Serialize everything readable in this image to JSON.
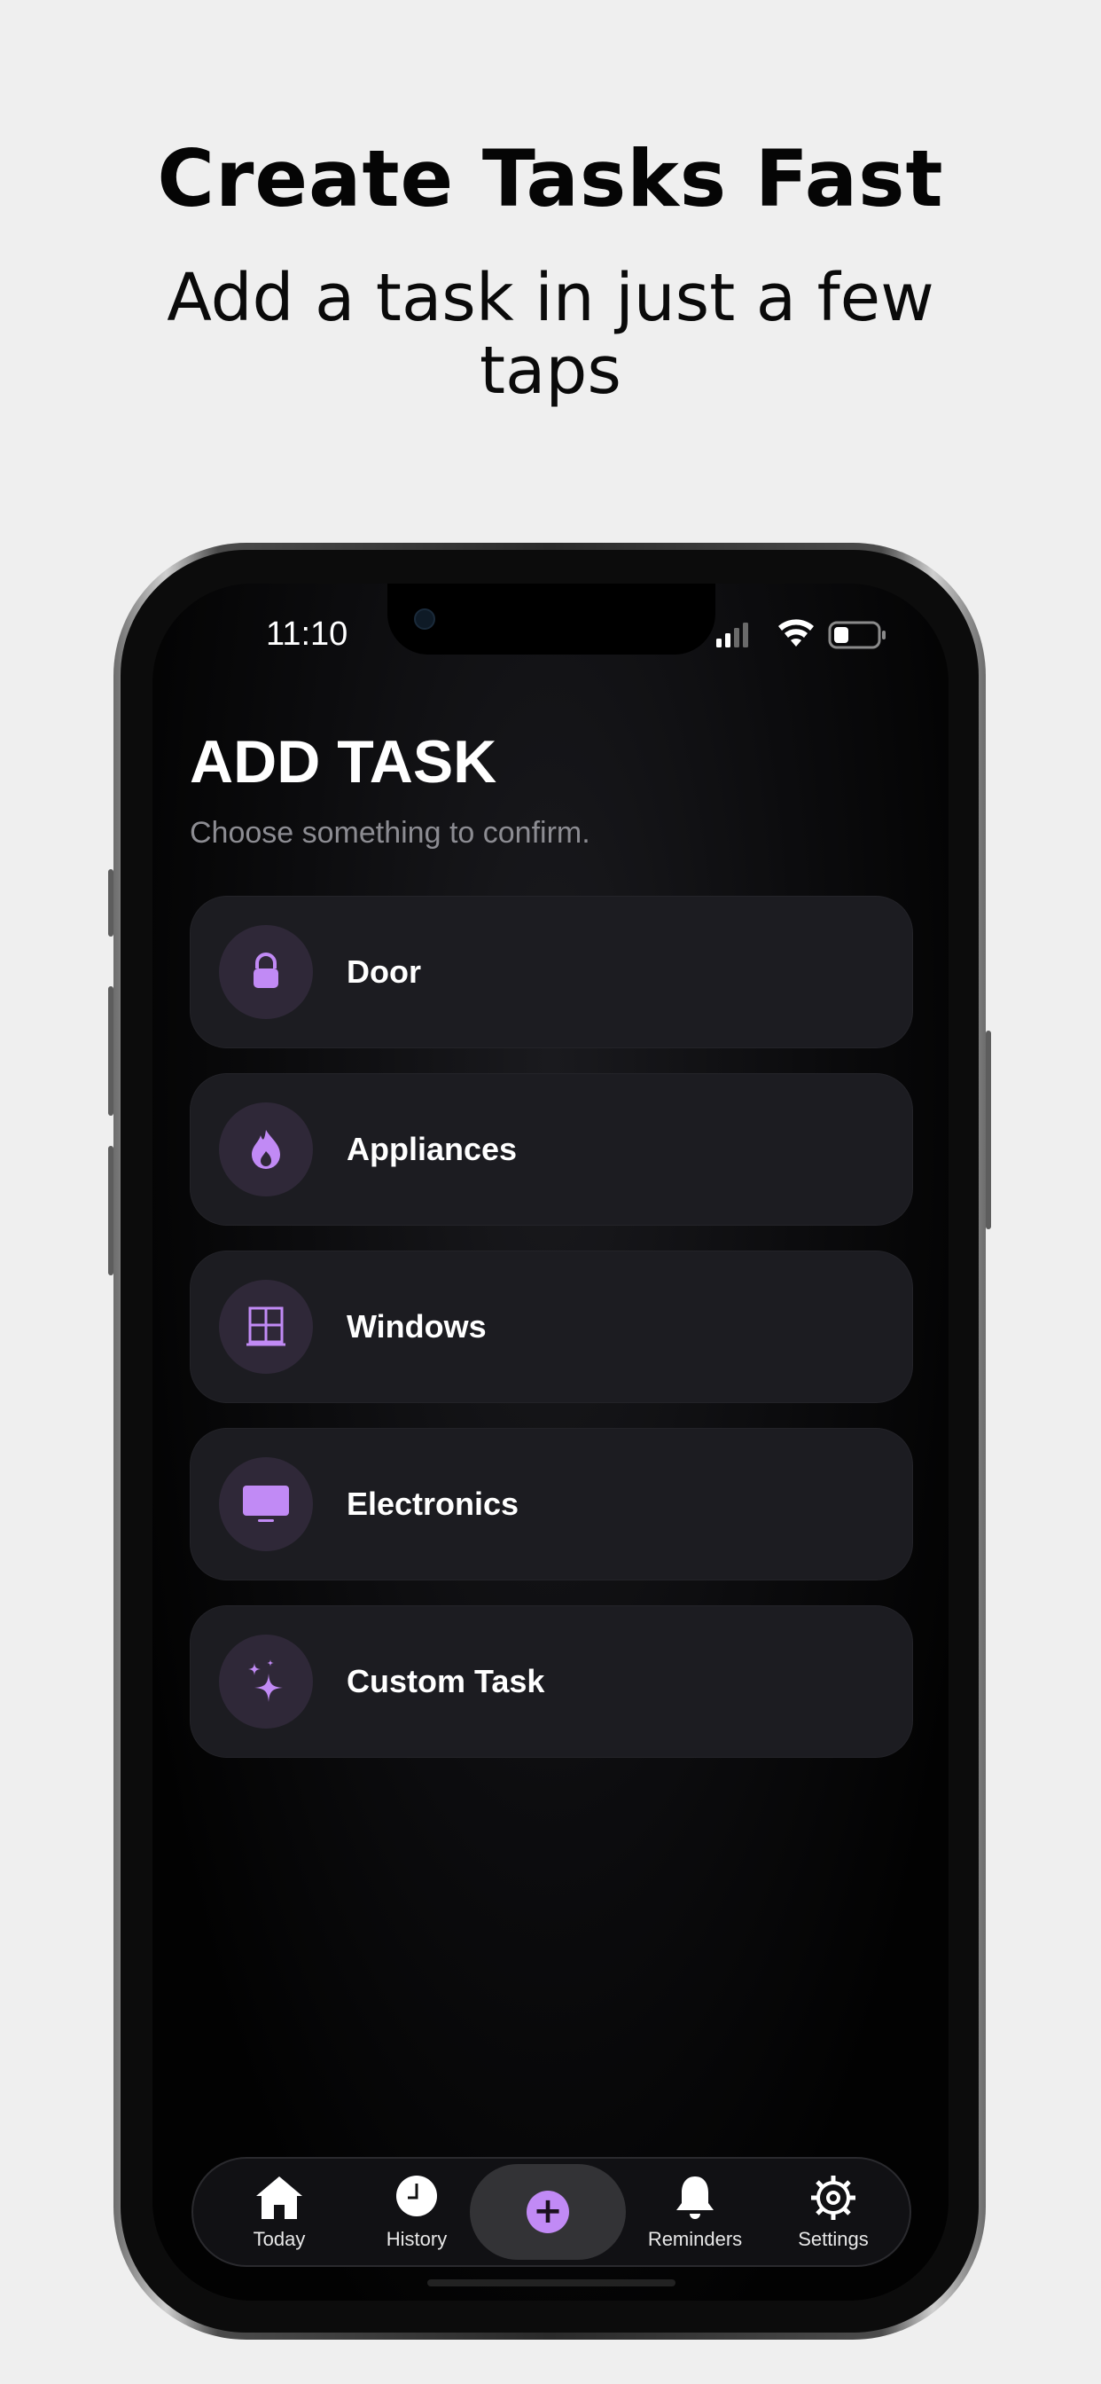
{
  "promo": {
    "headline": "Create Tasks Fast",
    "subline": "Add a task in just a few taps"
  },
  "status_bar": {
    "time": "11:10"
  },
  "page": {
    "title": "ADD TASK",
    "subtitle": "Choose something to confirm."
  },
  "tasks": [
    {
      "label": "Door",
      "icon": "lock-icon"
    },
    {
      "label": "Appliances",
      "icon": "flame-icon"
    },
    {
      "label": "Windows",
      "icon": "window-icon"
    },
    {
      "label": "Electronics",
      "icon": "tv-icon"
    },
    {
      "label": "Custom Task",
      "icon": "sparkles-icon"
    }
  ],
  "tabbar": {
    "today": "Today",
    "history": "History",
    "add": "+",
    "reminders": "Reminders",
    "settings": "Settings"
  },
  "colors": {
    "accent": "#c18af5",
    "card": "#1c1c21",
    "icon_circle": "#2f2838",
    "background": "#efefef"
  }
}
